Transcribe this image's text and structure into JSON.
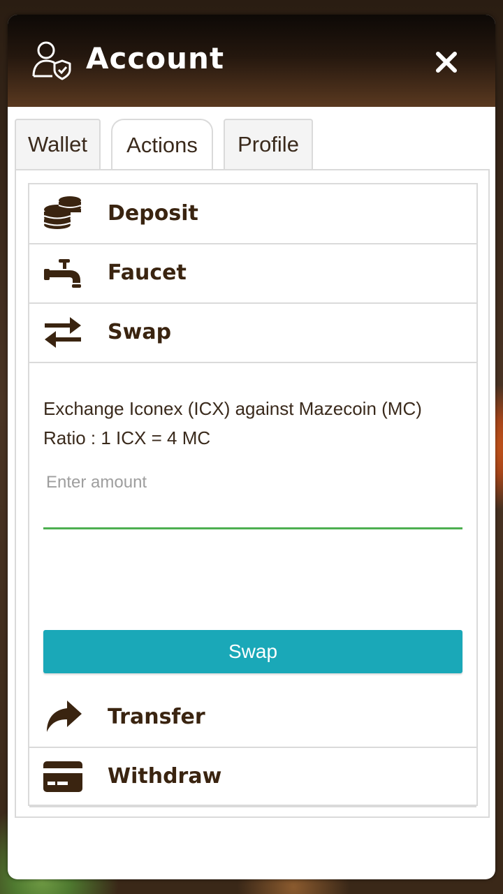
{
  "header": {
    "title": "Account",
    "close_icon": "close-icon",
    "account_icon": "user-shield-icon"
  },
  "tabs": [
    {
      "label": "Wallet",
      "active": false
    },
    {
      "label": "Actions",
      "active": true
    },
    {
      "label": "Profile",
      "active": false
    }
  ],
  "actions": {
    "deposit": {
      "label": "Deposit",
      "icon": "coins-icon"
    },
    "faucet": {
      "label": "Faucet",
      "icon": "faucet-icon"
    },
    "swap": {
      "label": "Swap",
      "icon": "exchange-arrows-icon"
    },
    "transfer": {
      "label": "Transfer",
      "icon": "share-arrow-icon"
    },
    "withdraw": {
      "label": "Withdraw",
      "icon": "credit-card-icon"
    }
  },
  "swap_panel": {
    "description": "Exchange Iconex (ICX) against Mazecoin (MC)",
    "ratio": "Ratio : 1 ICX = 4 MC",
    "amount_value": "",
    "amount_placeholder": "Enter amount",
    "button_label": "Swap"
  },
  "colors": {
    "accent": "#1aa8b8",
    "input_underline": "#4caf50",
    "label": "#3a2410"
  }
}
